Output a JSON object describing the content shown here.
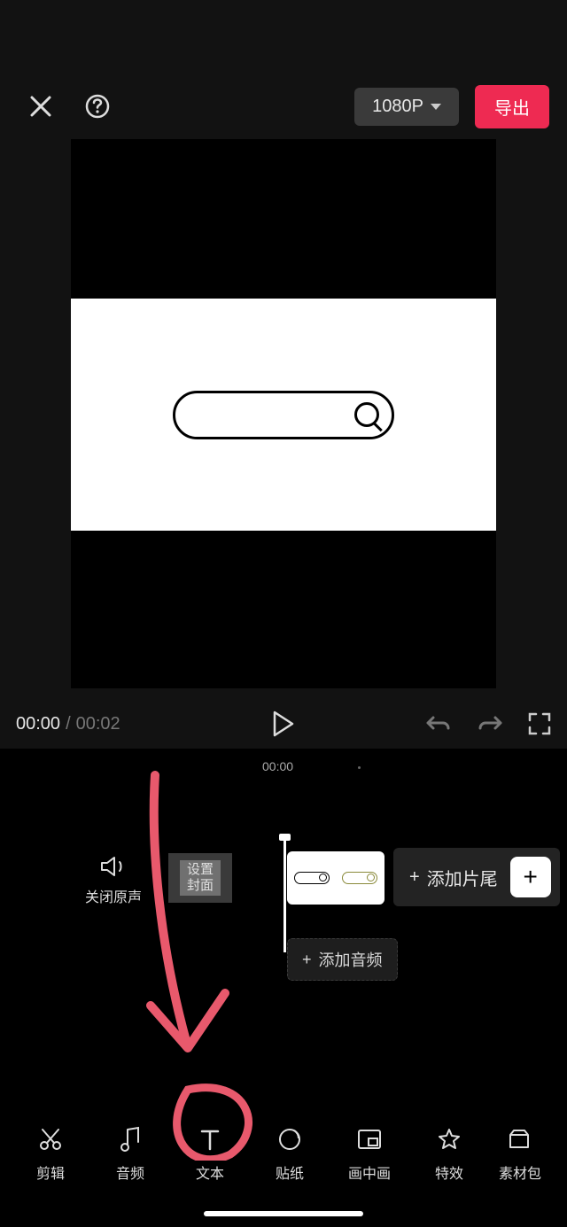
{
  "header": {
    "resolution": "1080P",
    "export": "导出"
  },
  "transport": {
    "current": "00:00",
    "separator": "/",
    "duration": "00:02"
  },
  "ruler": {
    "t0": "00:00"
  },
  "timeline": {
    "mute_label": "关闭原声",
    "set_cover": "设置\n封面",
    "add_tail": "添加片尾",
    "add_audio": "添加音频"
  },
  "tools": [
    {
      "id": "edit",
      "label": "剪辑"
    },
    {
      "id": "audio",
      "label": "音频"
    },
    {
      "id": "text",
      "label": "文本"
    },
    {
      "id": "sticker",
      "label": "贴纸"
    },
    {
      "id": "pip",
      "label": "画中画"
    },
    {
      "id": "effect",
      "label": "特效"
    },
    {
      "id": "material",
      "label": "素材包"
    }
  ]
}
